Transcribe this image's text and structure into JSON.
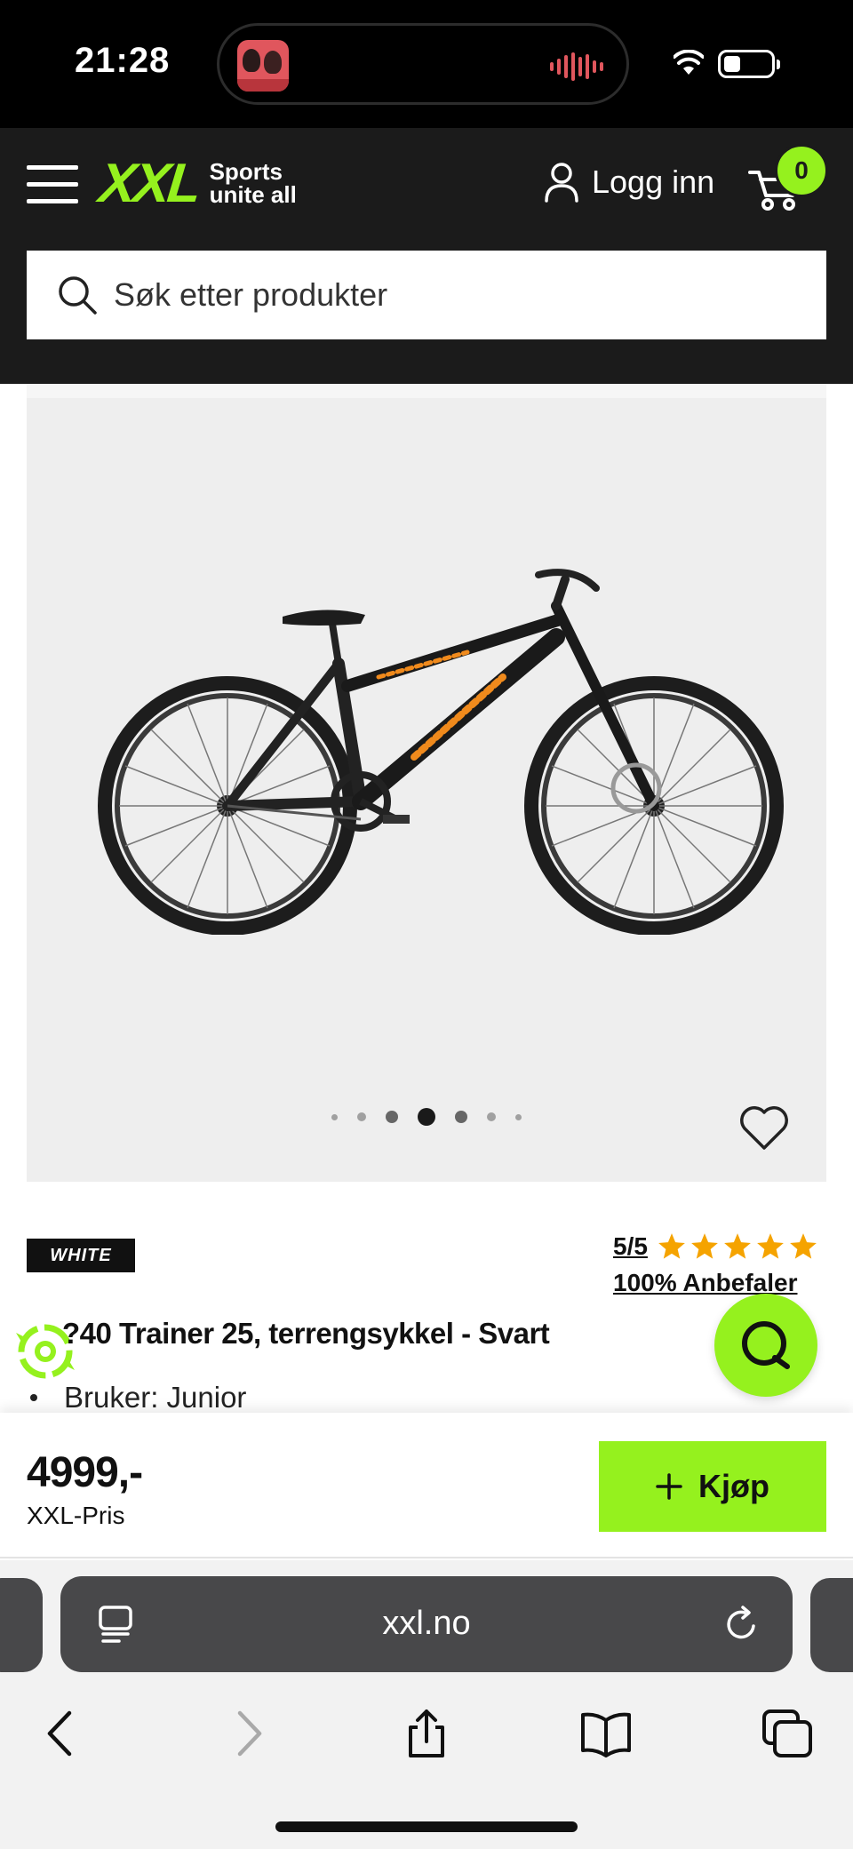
{
  "status_bar": {
    "time": "21:28"
  },
  "header": {
    "logo_main": "XXL",
    "logo_tagline_1": "Sports",
    "logo_tagline_2": "unite all",
    "login_label": "Logg inn",
    "cart_count": "0",
    "search_placeholder": "Søk etter produkter"
  },
  "gallery": {
    "slide_count": 7,
    "active_index": 3
  },
  "product": {
    "brand": "WHITE",
    "rating": "5/5",
    "stars_filled": 5,
    "star_color": "#f5a300",
    "recommend": "100% Anbefaler",
    "title": "?40 Trainer 25, terrengsykkel - Svart",
    "bullets": [
      "Bruker: Junior"
    ]
  },
  "buy_bar": {
    "price": "4999,-",
    "price_label": "XXL-Pris",
    "buy_label": "Kjøp"
  },
  "browser": {
    "url": "xxl.no"
  },
  "colors": {
    "accent": "#95f11e",
    "header_bg": "#1b1b1b"
  },
  "icons": {
    "menu": "hamburger-icon",
    "user": "user-icon",
    "cart": "cart-icon",
    "search": "search-icon",
    "favorite": "heart-icon",
    "chat": "chat-icon",
    "reader": "reader-icon",
    "reload": "reload-icon",
    "back": "back-icon",
    "forward": "forward-icon",
    "share": "share-icon",
    "bookmarks": "bookmarks-icon",
    "tabs": "tabs-icon"
  }
}
